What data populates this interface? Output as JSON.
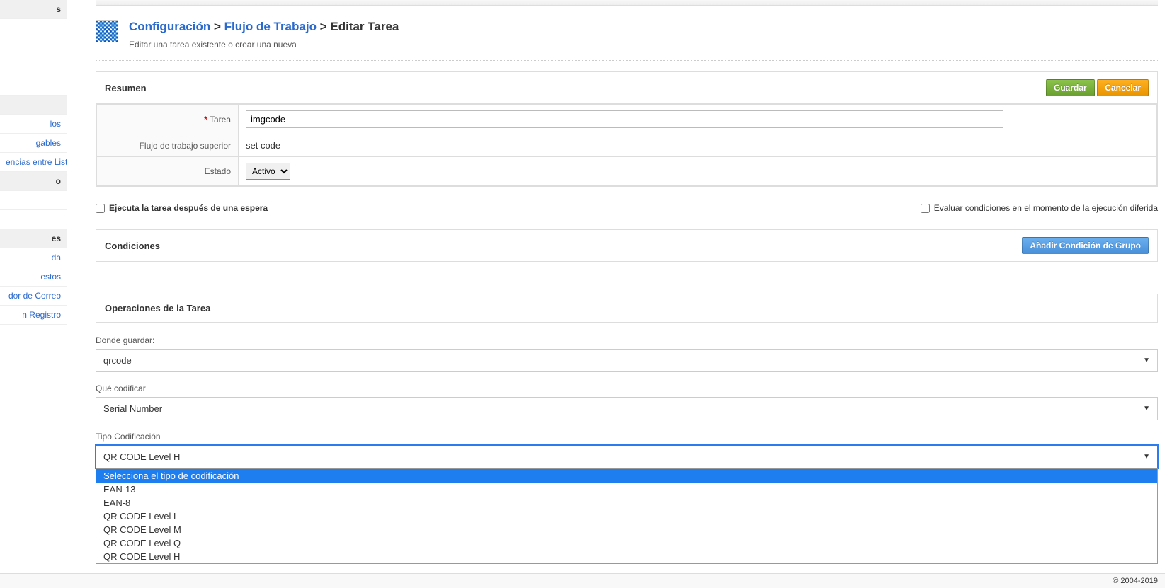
{
  "sidebar": {
    "items": [
      {
        "label": "s",
        "type": "heading"
      },
      {
        "label": "",
        "type": "blank"
      },
      {
        "label": "",
        "type": "blank"
      },
      {
        "label": "",
        "type": "blank"
      },
      {
        "label": "",
        "type": "blank"
      },
      {
        "label": "",
        "type": "heading"
      },
      {
        "label": "los",
        "type": "link"
      },
      {
        "label": "gables",
        "type": "link"
      },
      {
        "label": "encias entre Listas",
        "type": "link"
      },
      {
        "label": "o",
        "type": "active"
      },
      {
        "label": "",
        "type": "blank"
      },
      {
        "label": "",
        "type": "blank"
      },
      {
        "label": "es",
        "type": "heading"
      },
      {
        "label": "da",
        "type": "link"
      },
      {
        "label": "estos",
        "type": "link"
      },
      {
        "label": "dor de Correo",
        "type": "link"
      },
      {
        "label": "n Registro",
        "type": "link"
      }
    ]
  },
  "breadcrumb": {
    "configuracion": "Configuración",
    "flujo": "Flujo de Trabajo",
    "editar": "Editar Tarea",
    "subtitle": "Editar una tarea existente o crear una nueva"
  },
  "resumen": {
    "title": "Resumen",
    "save_btn": "Guardar",
    "cancel_btn": "Cancelar",
    "tarea_label": "Tarea",
    "tarea_value": "imgcode",
    "flujo_label": "Flujo de trabajo superior",
    "flujo_value": "set code",
    "estado_label": "Estado",
    "estado_value": "Activo"
  },
  "checkboxes": {
    "ejecuta_label": "Ejecuta la tarea después de una espera",
    "evaluar_label": "Evaluar condiciones en el momento de la ejecución diferida"
  },
  "condiciones": {
    "title": "Condiciones",
    "add_btn": "Añadir Condición de Grupo"
  },
  "operaciones": {
    "title": "Operaciones de la Tarea",
    "donde_guardar_label": "Donde guardar:",
    "donde_guardar_value": "qrcode",
    "que_codificar_label": "Qué codificar",
    "que_codificar_value": "Serial Number",
    "tipo_label": "Tipo Codificación",
    "tipo_value": "QR CODE Level H",
    "tipo_options": [
      {
        "label": "Selecciona el tipo de codificación",
        "highlighted": true
      },
      {
        "label": "EAN-13",
        "highlighted": false
      },
      {
        "label": "EAN-8",
        "highlighted": false
      },
      {
        "label": "QR CODE Level L",
        "highlighted": false
      },
      {
        "label": "QR CODE Level M",
        "highlighted": false
      },
      {
        "label": "QR CODE Level Q",
        "highlighted": false
      },
      {
        "label": "QR CODE Level H",
        "highlighted": false
      }
    ]
  },
  "footer": {
    "copyright": "© 2004-2019"
  }
}
